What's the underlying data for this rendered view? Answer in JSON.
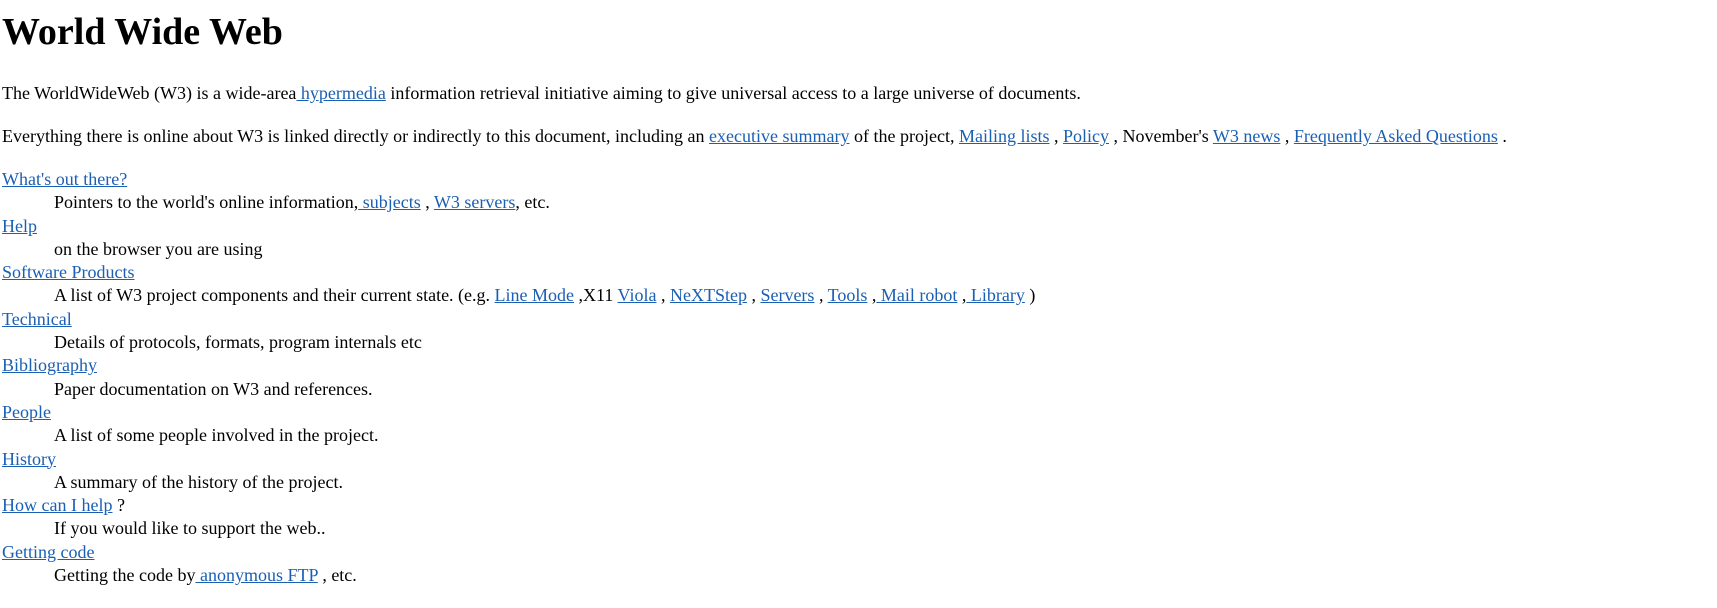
{
  "page": {
    "title": "World Wide Web"
  },
  "intro": {
    "p1_before": "The WorldWideWeb (W3) is a wide-area",
    "p1_link": " hypermedia",
    "p1_after": " information retrieval initiative aiming to give universal access to a large universe of documents.",
    "p2_before": "Everything there is online about W3 is linked directly or indirectly to this document, including an ",
    "p2_link_exec": "executive summary",
    "p2_mid1": " of the project, ",
    "p2_link_mailing": "Mailing lists",
    "p2_sep1": " , ",
    "p2_link_policy": "Policy",
    "p2_mid2": " , November's ",
    "p2_link_news": "W3 news",
    "p2_sep2": " , ",
    "p2_link_faq": "Frequently Asked Questions",
    "p2_end": " ."
  },
  "items": {
    "whats_out_there": {
      "term": "What's out there?",
      "desc_before": "Pointers to the world's online information,",
      "link_subjects": " subjects",
      "sep": " , ",
      "link_servers": "W3 servers",
      "desc_after": ", etc."
    },
    "help": {
      "term": "Help",
      "desc": "on the browser you are using"
    },
    "software_products": {
      "term": "Software Products",
      "desc_before": "A list of W3 project components and their current state. (e.g. ",
      "link_line_mode": "Line Mode",
      "mid_x11": " ,X11 ",
      "link_viola": "Viola",
      "sep1": " , ",
      "link_nextstep": "NeXTStep",
      "sep2": " , ",
      "link_servers": "Servers",
      "sep3": " , ",
      "link_tools": "Tools",
      "sep4": " ,",
      "link_mail_robot": " Mail robot",
      "sep5": " ,",
      "link_library": " Library",
      "desc_after": " )"
    },
    "technical": {
      "term": "Technical",
      "desc": "Details of protocols, formats, program internals etc"
    },
    "bibliography": {
      "term": "Bibliography",
      "desc": "Paper documentation on W3 and references."
    },
    "people": {
      "term": "People",
      "desc": "A list of some people involved in the project."
    },
    "history": {
      "term": "History",
      "desc": "A summary of the history of the project."
    },
    "how_can_i_help": {
      "term": "How can I help",
      "term_after": " ?",
      "desc": "If you would like to support the web.."
    },
    "getting_code": {
      "term": "Getting code",
      "desc_before": "Getting the code by",
      "link_ftp": " anonymous FTP",
      "desc_after": " , etc."
    }
  },
  "colors": {
    "link": "#1a5fb4",
    "text": "#000000",
    "background": "#ffffff"
  }
}
